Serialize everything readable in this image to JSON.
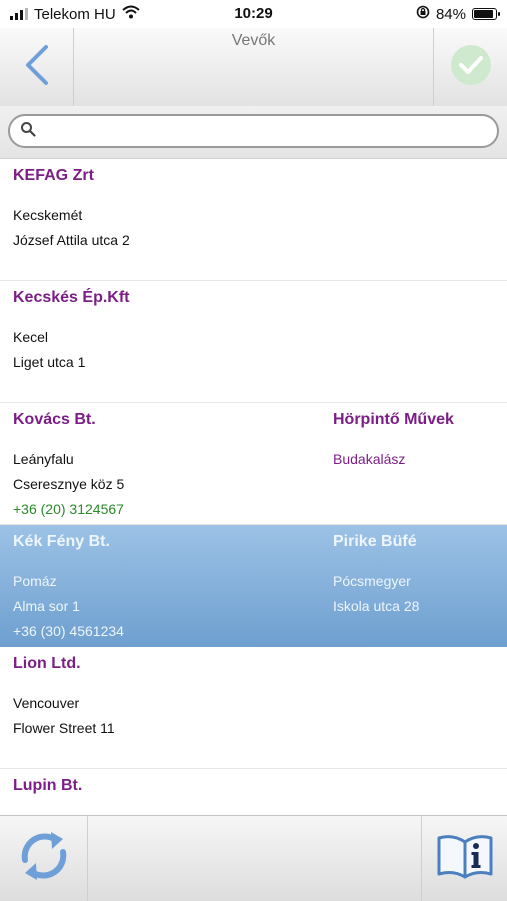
{
  "status": {
    "carrier": "Telekom HU",
    "time": "10:29",
    "battery": "84%",
    "battery_level": 0.84
  },
  "header": {
    "title": "Vevők"
  },
  "search": {
    "placeholder": ""
  },
  "customers": [
    {
      "left": {
        "name": "KEFAG Zrt",
        "city": "Kecskemét",
        "address": "József Attila utca 2",
        "phone": ""
      }
    },
    {
      "left": {
        "name": "Kecskés Ép.Kft",
        "city": "Kecel",
        "address": "Liget utca 1",
        "phone": ""
      }
    },
    {
      "left": {
        "name": "Kovács Bt.",
        "city": "Leányfalu",
        "address": "Cseresznye köz 5",
        "phone": "+36 (20) 3124567"
      },
      "right": {
        "name": "Hörpintő Művek",
        "city": "Budakalász",
        "address": ""
      }
    },
    {
      "selected": true,
      "left": {
        "name": "Kék Fény Bt.",
        "city": "Pomáz",
        "address": "Alma sor 1",
        "phone": "+36 (30) 4561234"
      },
      "right": {
        "name": "Pirike Büfé",
        "city": "Pócsmegyer",
        "address": "Iskola utca 28"
      }
    },
    {
      "left": {
        "name": "Lion Ltd.",
        "city": "Vencouver",
        "address": "Flower Street 11",
        "phone": ""
      }
    },
    {
      "left": {
        "name": "Lupin Bt.",
        "city": "",
        "address": "",
        "phone": ""
      }
    }
  ],
  "colors": {
    "accent": "#7b1f86",
    "phone": "#2a8a2a",
    "selection": "#7fabd8"
  },
  "icons": {
    "back": "chevron-left-icon",
    "ok": "checkmark-icon",
    "refresh": "refresh-icon",
    "info": "info-book-icon"
  }
}
